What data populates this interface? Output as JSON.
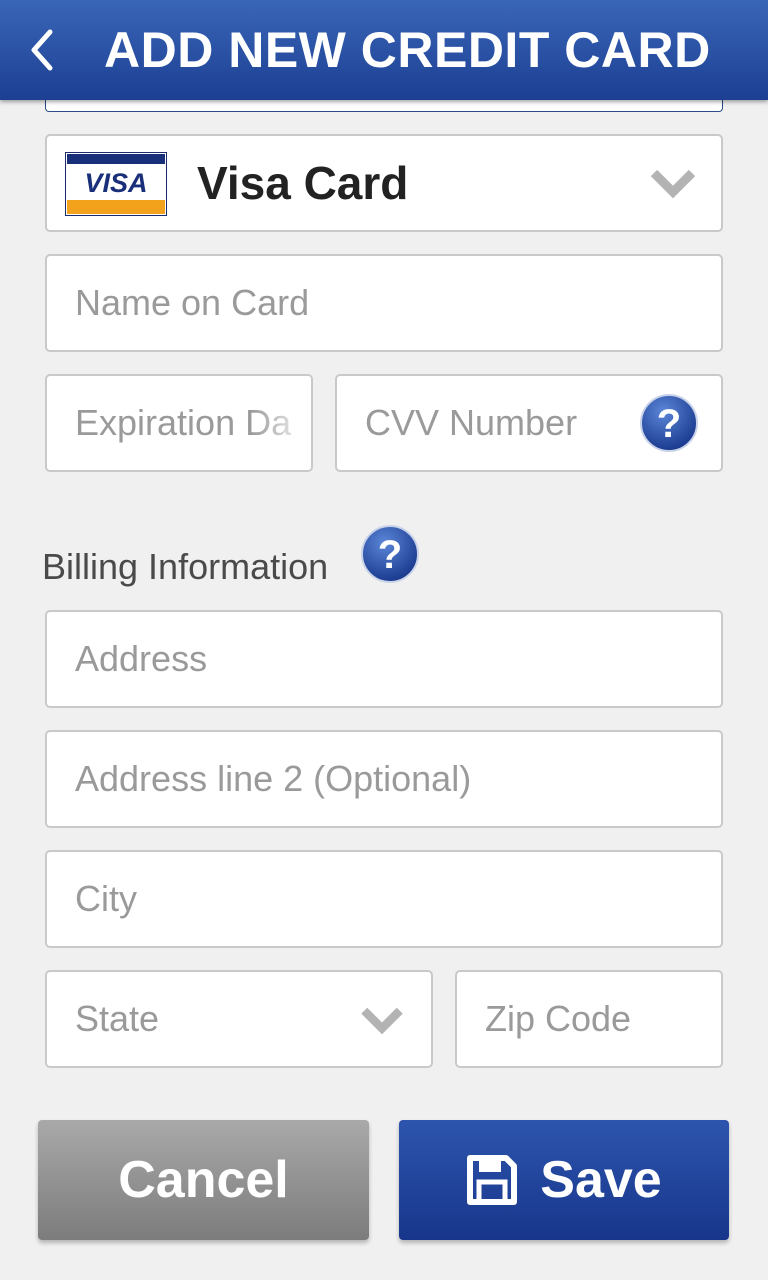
{
  "header": {
    "title": "ADD NEW CREDIT CARD",
    "back_icon": "chevron-left-icon"
  },
  "card": {
    "selected_type": "Visa Card",
    "logo_text": "VISA",
    "dropdown_icon": "chevron-down-icon"
  },
  "fields": {
    "name_on_card": "Name on Card",
    "expiration_date": "Expiration Da",
    "cvv": "CVV Number",
    "address": "Address",
    "address2": "Address line 2 (Optional)",
    "city": "City",
    "state": "State",
    "zip": "Zip Code"
  },
  "billing": {
    "label": "Billing Information",
    "help_icon": "question-mark-icon"
  },
  "buttons": {
    "cancel": "Cancel",
    "save": "Save",
    "save_icon": "floppy-disk-icon"
  },
  "colors": {
    "header_blue": "#2a52a8",
    "save_blue": "#1f44a0",
    "cancel_gray": "#8f8f8f",
    "background": "#f0f0f0"
  }
}
